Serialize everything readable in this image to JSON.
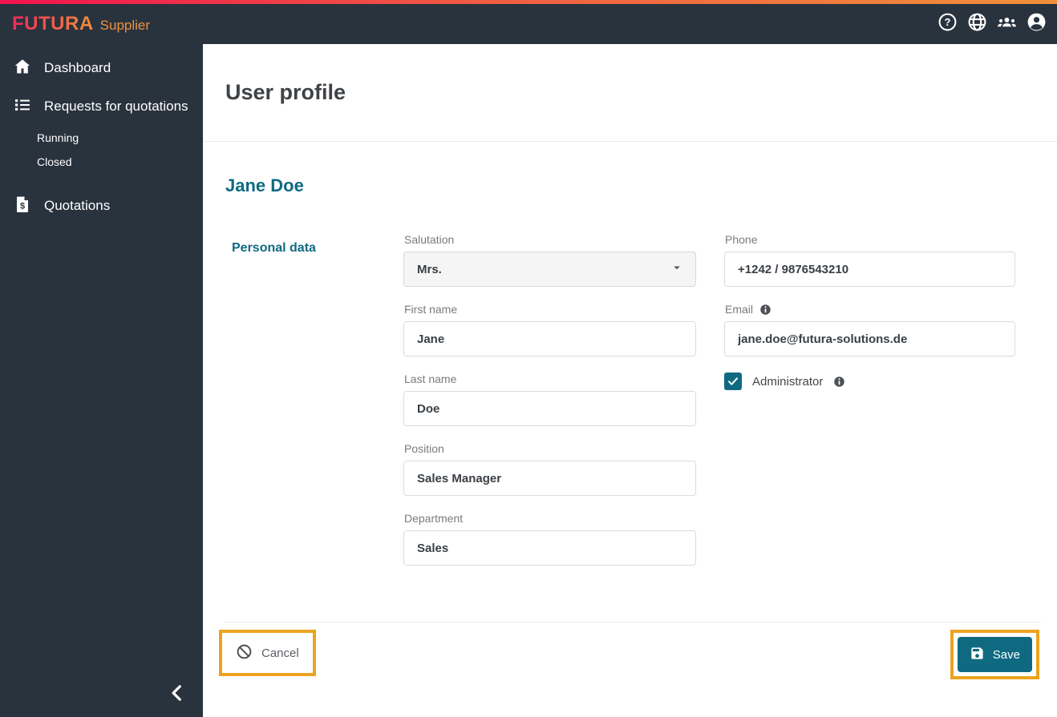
{
  "colors": {
    "header_dark": "#29333E",
    "accent_teal": "#0F6A81",
    "highlight_orange": "#EBA31F",
    "gradient_left": "#F1134F",
    "gradient_right": "#F0903A",
    "brand_suffix_orange": "#F0913E"
  },
  "brand": {
    "name": "FUTURA",
    "suffix": "Supplier"
  },
  "topbar": {
    "icons": [
      "help-icon",
      "language-globe-icon",
      "users-group-icon",
      "account-circle-icon"
    ]
  },
  "sidebar": {
    "items": [
      {
        "label": "Dashboard",
        "icon": "home-icon"
      },
      {
        "label": "Requests for quotations",
        "icon": "list-icon"
      },
      {
        "label": "Running"
      },
      {
        "label": "Closed"
      },
      {
        "label": "Quotations",
        "icon": "quotation-document-icon"
      }
    ],
    "collapse_icon": "chevron-left-icon"
  },
  "main": {
    "title": "User profile",
    "user_name": "Jane Doe",
    "section_label": "Personal data"
  },
  "form": {
    "salutation": {
      "label": "Salutation",
      "value": "Mrs."
    },
    "first_name": {
      "label": "First name",
      "value": "Jane"
    },
    "last_name": {
      "label": "Last name",
      "value": "Doe"
    },
    "position": {
      "label": "Position",
      "value": "Sales Manager"
    },
    "department": {
      "label": "Department",
      "value": "Sales"
    },
    "phone": {
      "label": "Phone",
      "value": "+1242 / 9876543210"
    },
    "email": {
      "label": "Email",
      "value": "jane.doe@futura-solutions.de",
      "info_icon": "info-icon"
    },
    "administrator": {
      "label": "Administrator",
      "checked": "true",
      "info_icon": "info-icon"
    }
  },
  "actions": {
    "cancel": "Cancel",
    "save": "Save"
  }
}
